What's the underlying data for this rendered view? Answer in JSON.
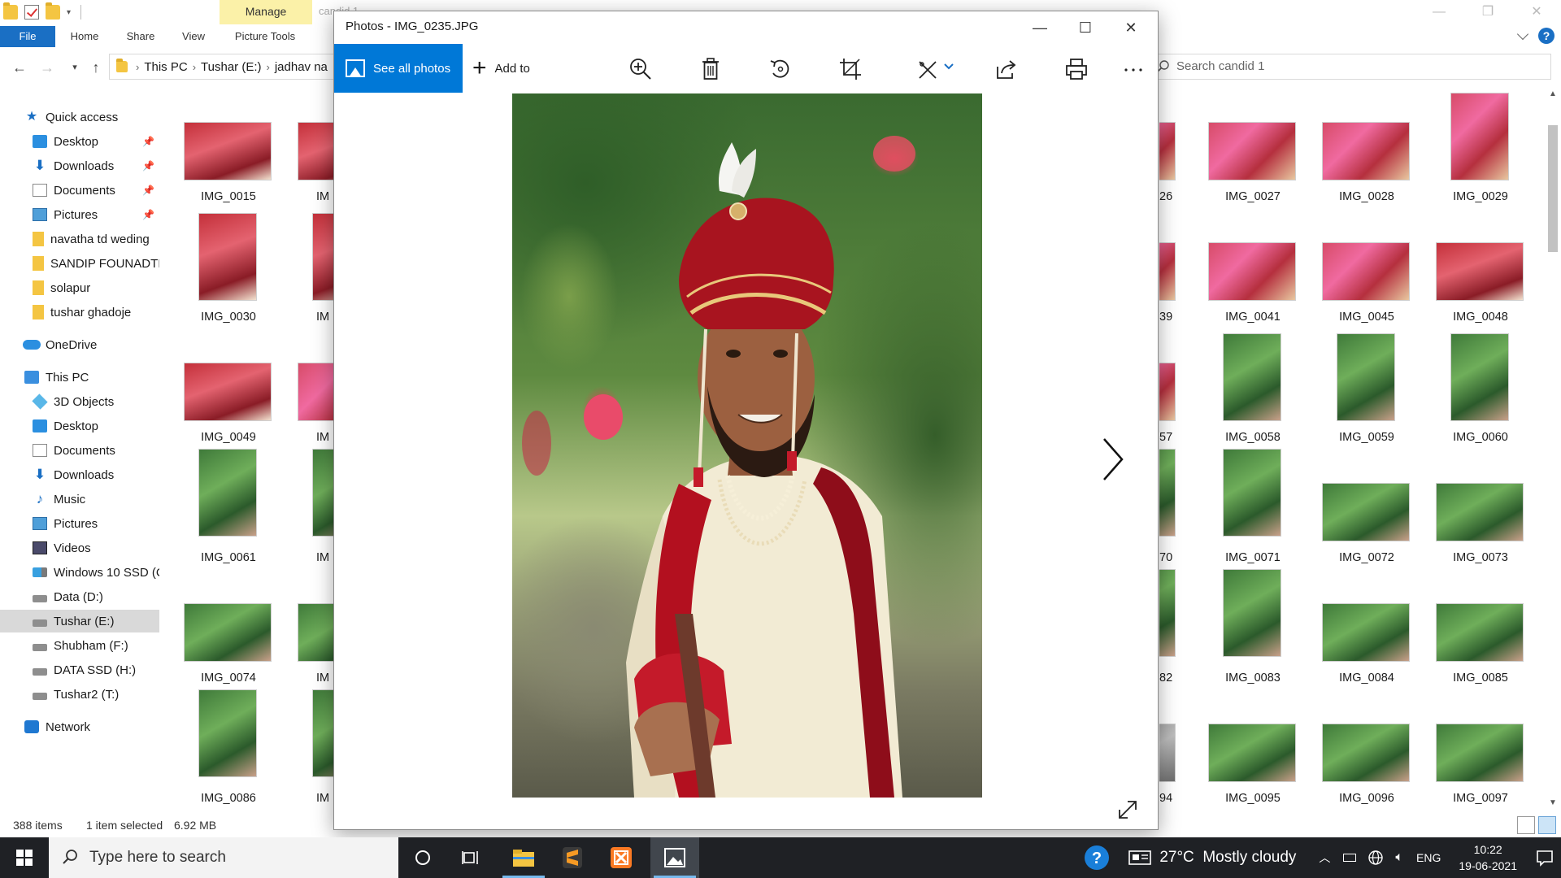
{
  "explorer": {
    "title_tab_contextual": "Manage",
    "title_faded": "candid 1",
    "ribbon": {
      "tabs": [
        "File",
        "Home",
        "Share",
        "View",
        "Picture Tools"
      ]
    },
    "address": {
      "crumbs": [
        "This PC",
        "Tushar (E:)",
        "jadhav na"
      ]
    },
    "search": {
      "placeholder": "Search candid 1"
    },
    "nav": {
      "quick_access": "Quick access",
      "quick_items": [
        "Desktop",
        "Downloads",
        "Documents",
        "Pictures",
        "navatha td weding",
        "SANDIP FOUNADTIO",
        "solapur",
        "tushar ghadoje"
      ],
      "onedrive": "OneDrive",
      "this_pc": "This PC",
      "pc_items": [
        "3D Objects",
        "Desktop",
        "Documents",
        "Downloads",
        "Music",
        "Pictures",
        "Videos",
        "Windows 10 SSD (C",
        "Data (D:)",
        "Tushar (E:)",
        "Shubham (F:)",
        "DATA SSD (H:)",
        "Tushar2 (T:)"
      ],
      "network": "Network"
    },
    "files_left": [
      [
        "IMG_0015",
        "IM"
      ],
      [
        "IMG_0030",
        "IM"
      ],
      [
        "IMG_0049",
        "IM"
      ],
      [
        "IMG_0061",
        "IM"
      ],
      [
        "IMG_0074",
        "IM"
      ],
      [
        "IMG_0086",
        "IM"
      ]
    ],
    "files_right": [
      [
        "26",
        "IMG_0027",
        "IMG_0028",
        "IMG_0029"
      ],
      [
        "39",
        "IMG_0041",
        "IMG_0045",
        "IMG_0048"
      ],
      [
        "57",
        "IMG_0058",
        "IMG_0059",
        "IMG_0060"
      ],
      [
        "70",
        "IMG_0071",
        "IMG_0072",
        "IMG_0073"
      ],
      [
        "82",
        "IMG_0083",
        "IMG_0084",
        "IMG_0085"
      ],
      [
        "94",
        "IMG_0095",
        "IMG_0096",
        "IMG_0097"
      ]
    ],
    "status": {
      "count": "388 items",
      "selected": "1 item selected",
      "size": "6.92 MB"
    }
  },
  "photos": {
    "title": "Photos - IMG_0235.JPG",
    "see_all": "See all photos",
    "add_to": "Add to"
  },
  "taskbar": {
    "search_placeholder": "Type here to search",
    "weather": "27°C  Mostly cloudy",
    "lang": "ENG",
    "time": "10:22",
    "date": "19-06-2021"
  },
  "colors": {
    "accent": "#0078d7",
    "file_tab": "#1a6fc4",
    "manage_tab": "#fbf1a8",
    "taskbar": "#1f2125"
  }
}
